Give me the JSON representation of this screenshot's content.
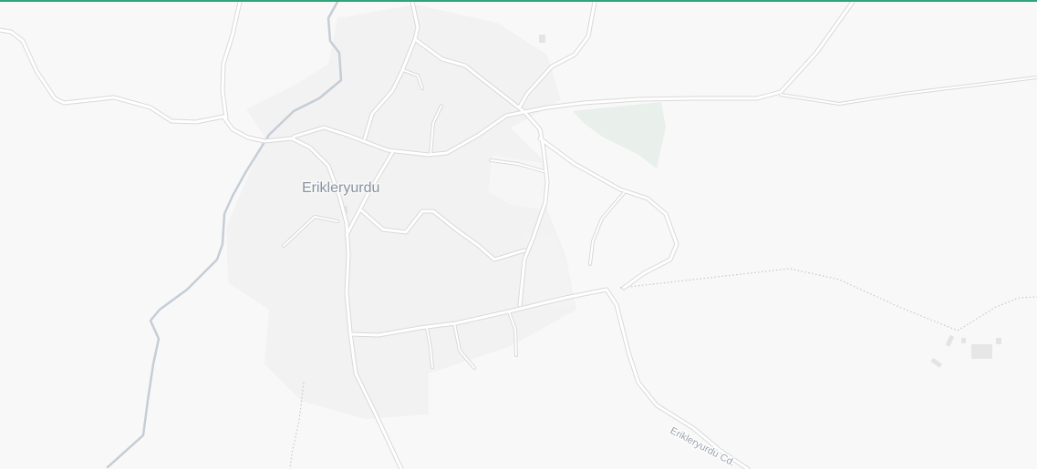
{
  "map": {
    "place_label": "Erikleryurdu",
    "road_label": "Erikleryurdu Cd.",
    "colors": {
      "background": "#f8f8f8",
      "settlement": "#f1f1f1",
      "park": "#e8efea",
      "water": "#c5cdd6",
      "road": "#ffffff",
      "road_casing": "#d9d9d9",
      "accent_bar": "#2fa37a"
    }
  }
}
